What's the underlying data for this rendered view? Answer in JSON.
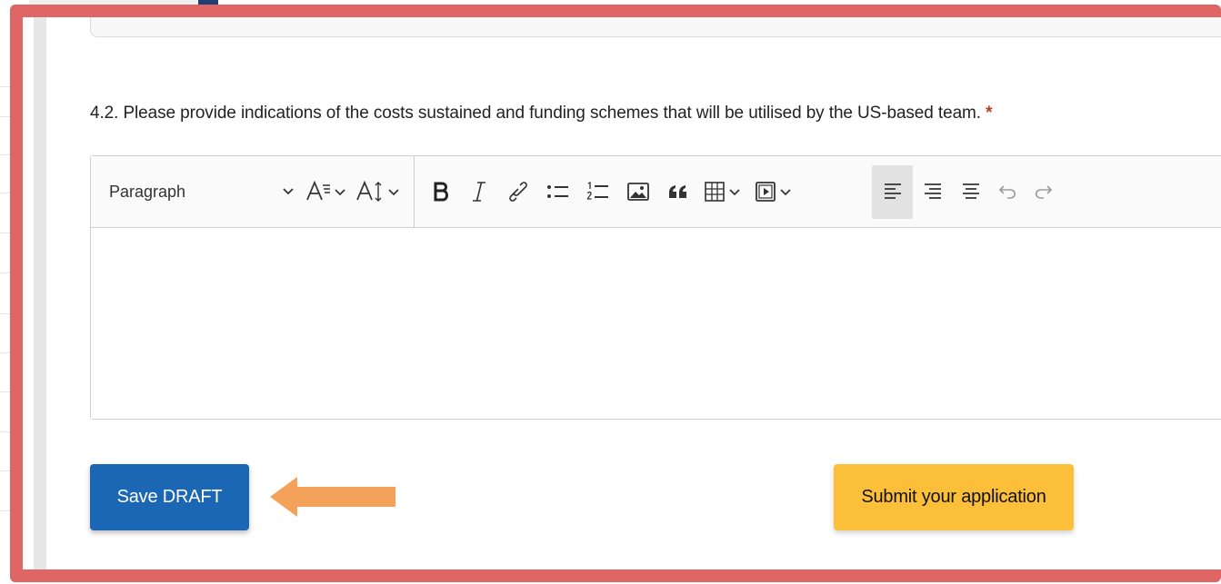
{
  "question": {
    "text": "4.2. Please provide indications of the costs sustained and funding schemes that will be utilised by the US-based team.",
    "required_mark": "*"
  },
  "editor": {
    "heading_select_value": "Paragraph",
    "toolbar_icons": [
      "chevron-down-icon",
      "font-family-icon",
      "font-size-icon",
      "bold-icon",
      "italic-icon",
      "link-icon",
      "bulleted-list-icon",
      "numbered-list-icon",
      "image-icon",
      "blockquote-icon",
      "table-icon",
      "media-icon",
      "align-left-icon",
      "align-center-icon",
      "align-right-icon",
      "undo-icon",
      "redo-icon"
    ],
    "content": ""
  },
  "actions": {
    "save_label": "Save DRAFT",
    "submit_label": "Submit your application"
  },
  "colors": {
    "highlight_frame": "#e06565",
    "save_button": "#1b67b3",
    "submit_button": "#fbbf3a",
    "arrow": "#f4a25a"
  }
}
